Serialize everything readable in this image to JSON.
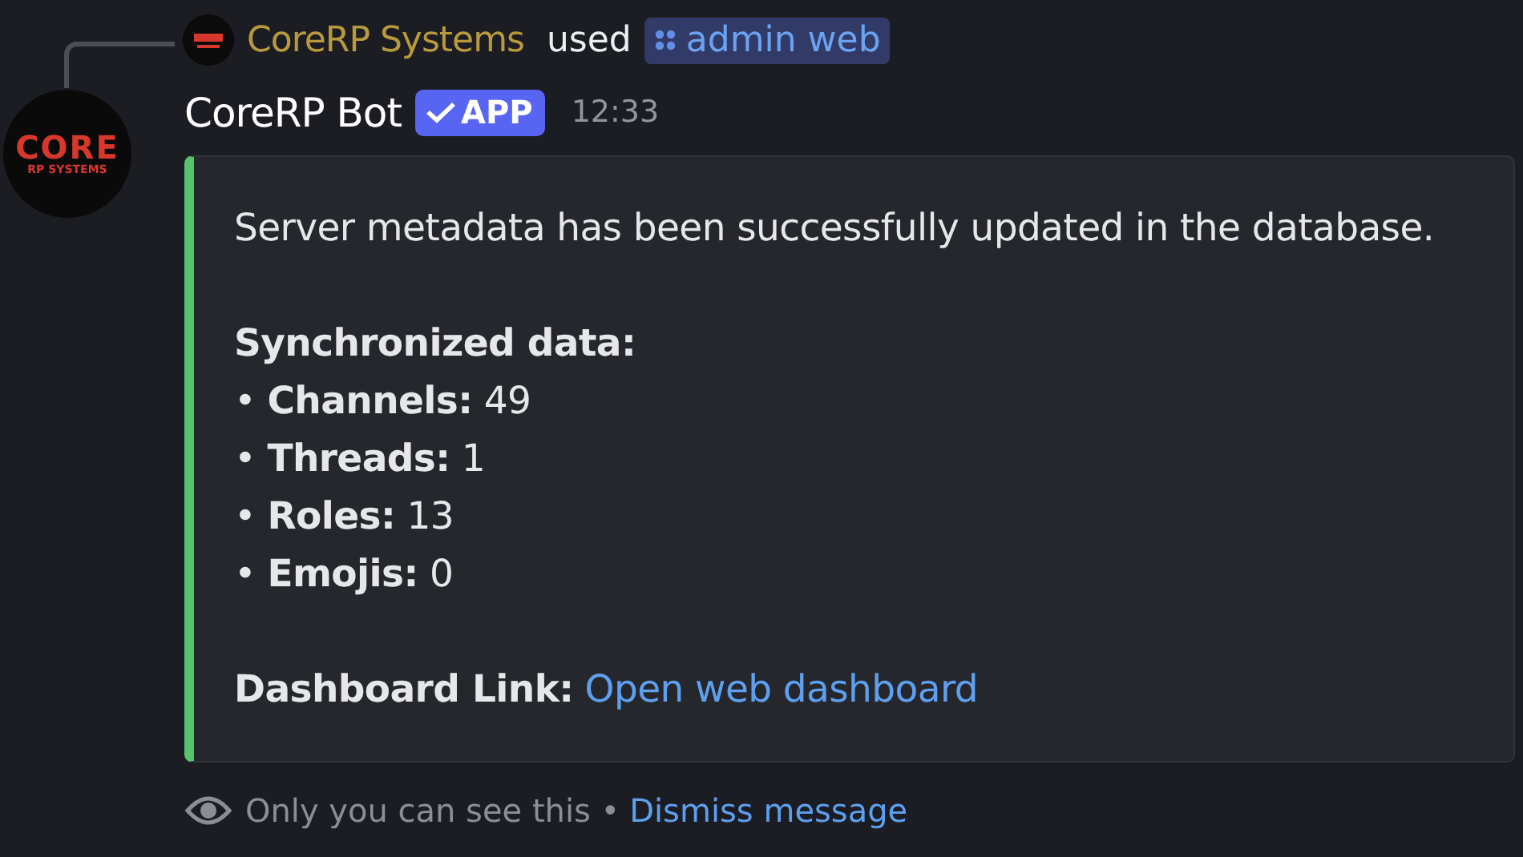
{
  "reply": {
    "user": "CoreRP Systems",
    "action": "used",
    "command": "admin web"
  },
  "message": {
    "author": "CoreRP Bot",
    "badge": "APP",
    "time": "12:33",
    "avatar_logo": [
      "CORE",
      "RP SYSTEMS"
    ]
  },
  "embed": {
    "color": "#57c46c",
    "description": "Server metadata has been successfully updated in the database.",
    "heading": "Synchronized data:",
    "items": [
      "• **Channels:** 49",
      "• **Threads:** 1",
      "• **Roles:** 13",
      "• **Emojis:** 0"
    ],
    "link_label": "Dashboard Link:",
    "link_text": "Open web dashboard"
  },
  "footer": {
    "note": "Only you can see this •",
    "action": "Dismiss message"
  }
}
